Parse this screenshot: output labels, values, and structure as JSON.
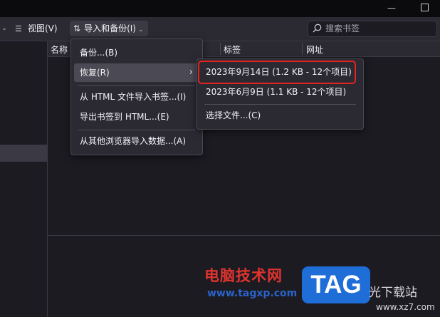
{
  "titlebar": {
    "minimize_icon": "minimize-icon",
    "maximize_icon": "maximize-icon"
  },
  "toolbar": {
    "organize_chevron_icon": "chevron-down-icon",
    "view_label": "视图(V)",
    "view_icon": "list-icon",
    "import_label": "导入和备份(I)",
    "import_icon": "sort-arrows-icon",
    "search_placeholder": "搜索书签",
    "search_icon": "search-icon"
  },
  "list": {
    "columns": [
      "名称",
      "标签",
      "网址"
    ]
  },
  "main_menu": {
    "items": [
      {
        "label": "备份...(B)"
      },
      {
        "label": "恢复(R)",
        "has_submenu": true
      },
      {
        "label": "从 HTML 文件导入书签...(I)"
      },
      {
        "label": "导出书签到 HTML...(E)"
      },
      {
        "label": "从其他浏览器导入数据...(A)"
      }
    ]
  },
  "restore_submenu": {
    "items": [
      {
        "label": "2023年9月14日 (1.2 KB - 12个项目)"
      },
      {
        "label": "2023年6月9日 (1.1 KB - 12个项目)"
      },
      {
        "label": "选择文件...(C)"
      }
    ],
    "highlight_color": "#e0241f"
  },
  "watermark": {
    "site_name": "电脑技术网",
    "site_url": "www.tagxp.com",
    "logo_text": "TAG",
    "right_text": "光下载站",
    "right_url": "www.xz7.com",
    "logo_color": "#1f6dd6",
    "name_color": "#e0332e"
  }
}
